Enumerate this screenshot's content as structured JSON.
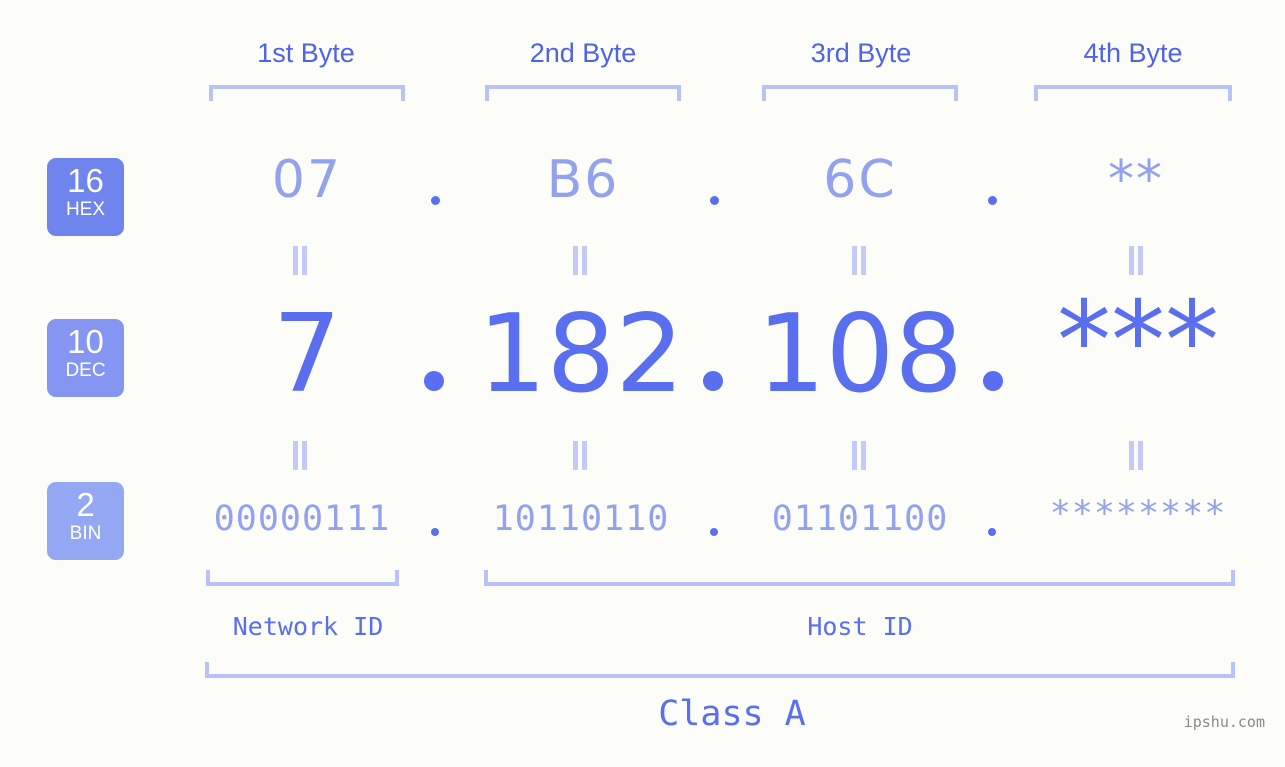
{
  "page": {
    "background": "#fcfdf8",
    "accent_strong": "#5a6ef0",
    "accent_light": "#93a2ee",
    "bracket_color": "#b9c2f8",
    "watermark": "ipshu.com"
  },
  "byte_headers": [
    {
      "label": "1st Byte"
    },
    {
      "label": "2nd Byte"
    },
    {
      "label": "3rd Byte"
    },
    {
      "label": "4th Byte"
    }
  ],
  "rows": [
    {
      "badge_number": "16",
      "badge_name": "HEX",
      "badge_color": "#7084ee",
      "octets": [
        "07",
        "B6",
        "6C",
        "**"
      ]
    },
    {
      "badge_number": "10",
      "badge_name": "DEC",
      "badge_color": "#8596f2",
      "octets": [
        "7",
        "182",
        "108",
        "***"
      ]
    },
    {
      "badge_number": "2",
      "badge_name": "BIN",
      "badge_color": "#93a7f3",
      "octets": [
        "00000111",
        "10110110",
        "01101100",
        "********"
      ]
    }
  ],
  "separator": ".",
  "equals_marks": {
    "glyph": "||",
    "count_per_row_gap": 4
  },
  "id_sections": [
    {
      "label": "Network ID"
    },
    {
      "label": "Host ID"
    }
  ],
  "class_section": {
    "label": "Class A"
  }
}
